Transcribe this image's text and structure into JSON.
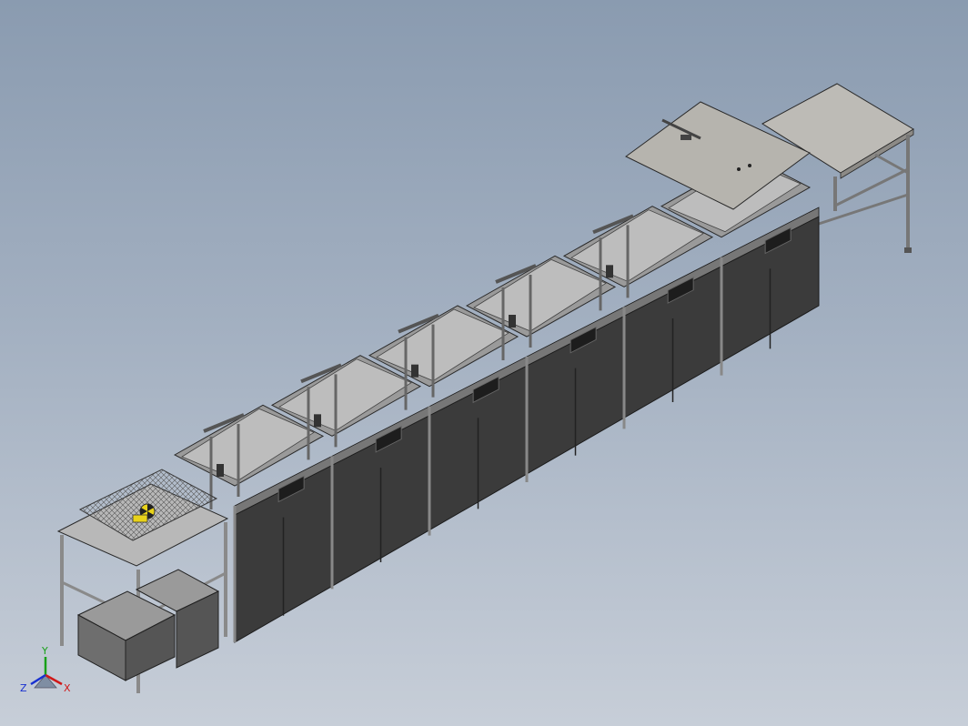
{
  "viewport": {
    "background_top": "#8a9bb0",
    "background_bottom": "#c7ced8"
  },
  "model": {
    "frame_color": "#b9b9b9",
    "cabinet_color": "#3a3a3a",
    "tank_interior_color": "#8f8f8f",
    "lid_color": "#b8b6b0",
    "accent_color": "#e8d21a",
    "stations": 6,
    "lifters": 5
  },
  "triad": {
    "x_label": "X",
    "y_label": "Y",
    "z_label": "Z",
    "x_color": "#d01818",
    "y_color": "#18a018",
    "z_color": "#1830d0"
  }
}
